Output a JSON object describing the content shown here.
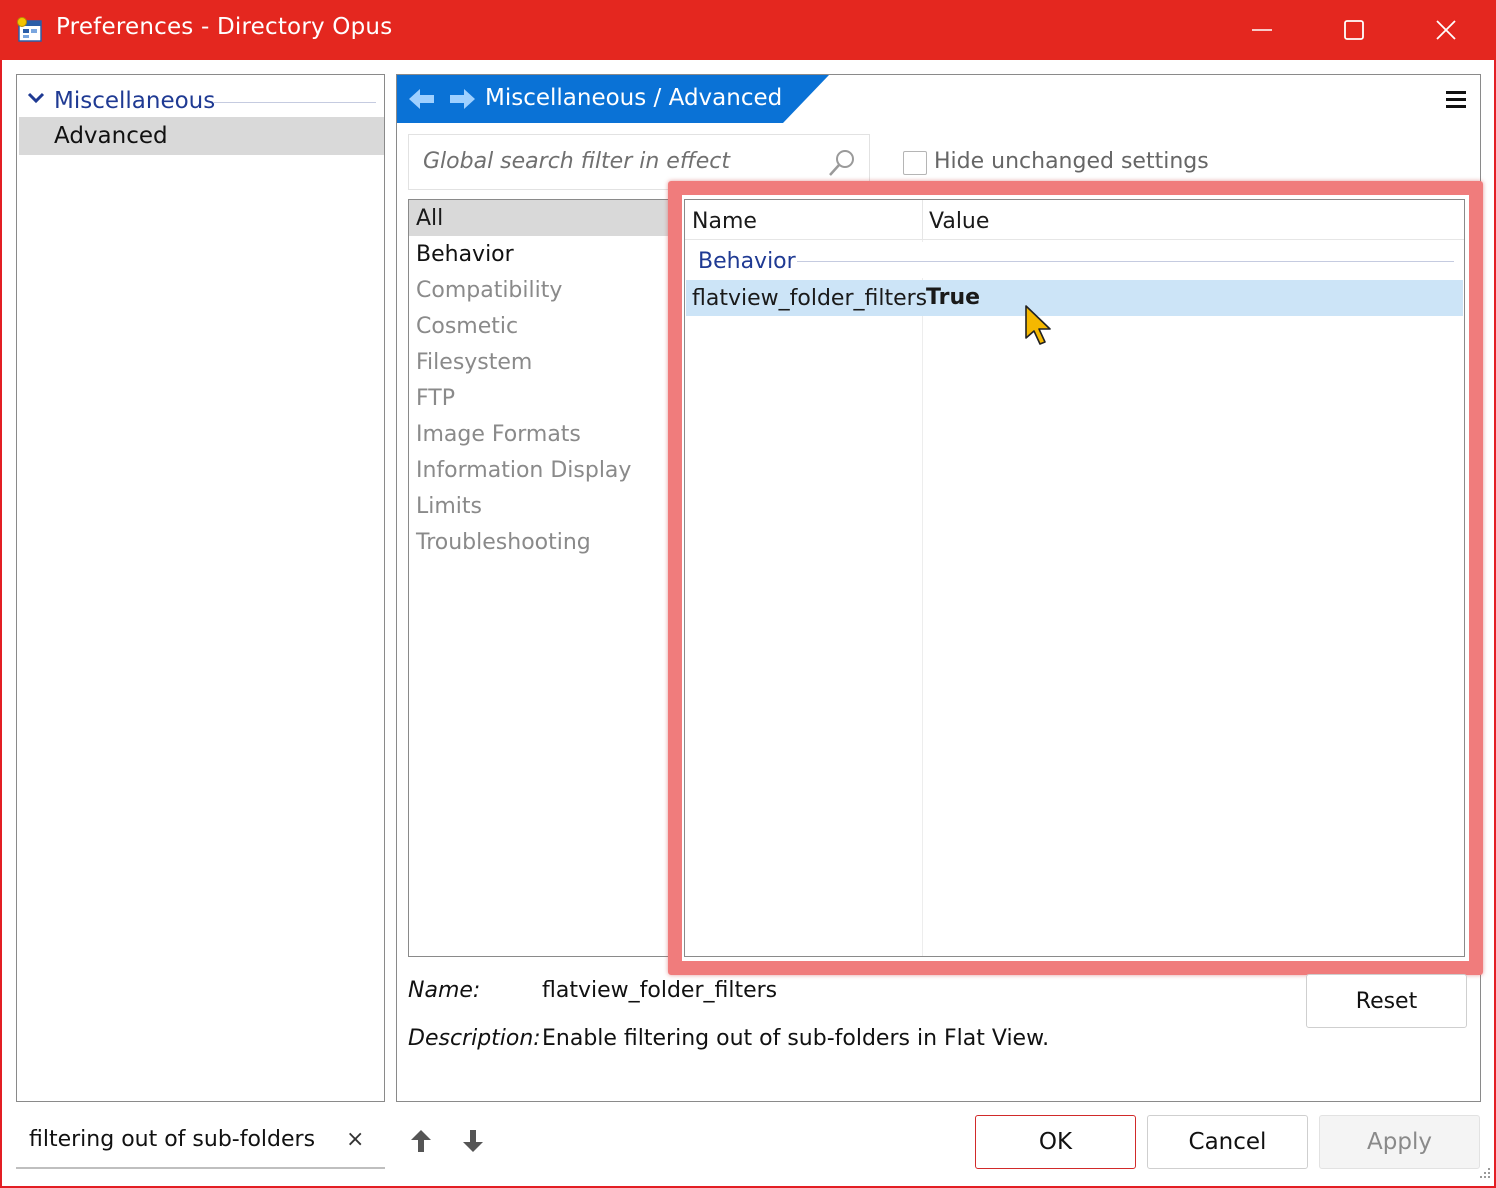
{
  "window": {
    "title": "Preferences - Directory Opus",
    "title_bar_color": "#e4271f"
  },
  "tree": {
    "group_label": "Miscellaneous",
    "selected_item": "Advanced"
  },
  "breadcrumb": {
    "text": "Miscellaneous / Advanced",
    "color": "#0a72d6"
  },
  "search": {
    "placeholder": "Global search filter in effect"
  },
  "hide_unchanged": {
    "label": "Hide unchanged settings",
    "checked": false
  },
  "categories": [
    {
      "label": "All",
      "state": "selected"
    },
    {
      "label": "Behavior",
      "state": "enabled"
    },
    {
      "label": "Compatibility",
      "state": "dim"
    },
    {
      "label": "Cosmetic",
      "state": "dim"
    },
    {
      "label": "Filesystem",
      "state": "dim"
    },
    {
      "label": "FTP",
      "state": "dim"
    },
    {
      "label": "Image Formats",
      "state": "dim"
    },
    {
      "label": "Information Display",
      "state": "dim"
    },
    {
      "label": "Limits",
      "state": "dim"
    },
    {
      "label": "Troubleshooting",
      "state": "dim"
    }
  ],
  "settings_table": {
    "columns": [
      "Name",
      "Value"
    ],
    "group": "Behavior",
    "rows": [
      {
        "name": "flatview_folder_filters",
        "value": "True"
      }
    ]
  },
  "details": {
    "name_label": "Name:",
    "name_value": "flatview_folder_filters",
    "description_label": "Description:",
    "description_value": "Enable filtering out of sub-folders in Flat View.",
    "reset_label": "Reset"
  },
  "filter": {
    "value": "filtering out of sub-folders",
    "clear_glyph": "×"
  },
  "buttons": {
    "ok": "OK",
    "cancel": "Cancel",
    "apply": "Apply"
  },
  "icons": [
    "app-icon",
    "minimize-icon",
    "maximize-icon",
    "close-icon",
    "chevron-down-icon",
    "back-arrow-icon",
    "forward-arrow-icon",
    "hamburger-menu-icon",
    "search-icon",
    "mouse-cursor-icon",
    "arrow-up-icon",
    "arrow-down-icon",
    "resize-grip-icon"
  ]
}
